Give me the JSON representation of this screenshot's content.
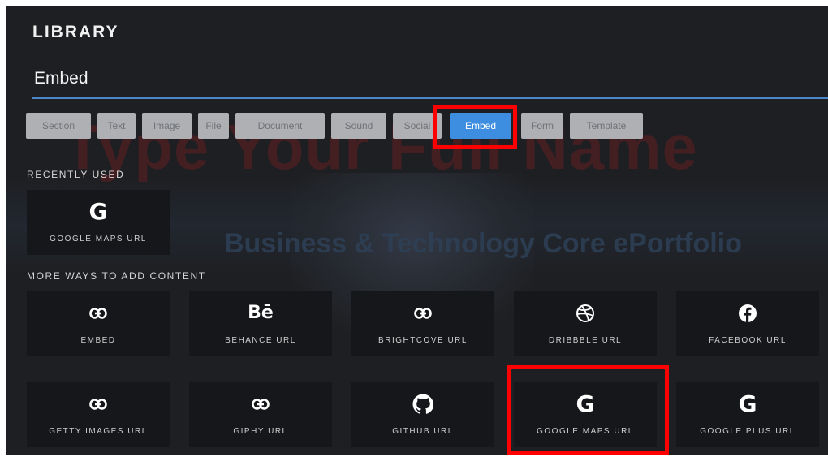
{
  "library": {
    "title": "LIBRARY",
    "heading": "Embed"
  },
  "tabs": [
    {
      "label": "Section"
    },
    {
      "label": "Text"
    },
    {
      "label": "Image"
    },
    {
      "label": "File"
    },
    {
      "label": "Document"
    },
    {
      "label": "Sound"
    },
    {
      "label": "Social"
    },
    {
      "label": "Embed",
      "active": true
    },
    {
      "label": "Form"
    },
    {
      "label": "Template"
    }
  ],
  "background_site": {
    "name_text": "Type Your Full Name",
    "subtitle_text": "Business & Technology Core ePortfolio"
  },
  "recently_used": {
    "label": "RECENTLY USED",
    "items": [
      {
        "label": "GOOGLE MAPS URL",
        "icon": "google-icon"
      }
    ]
  },
  "more_ways": {
    "label": "MORE WAYS TO ADD CONTENT",
    "items": [
      {
        "label": "EMBED",
        "icon": "link-icon"
      },
      {
        "label": "BEHANCE URL",
        "icon": "behance-icon"
      },
      {
        "label": "BRIGHTCOVE URL",
        "icon": "link-icon"
      },
      {
        "label": "DRIBBBLE URL",
        "icon": "dribbble-icon"
      },
      {
        "label": "FACEBOOK URL",
        "icon": "facebook-icon"
      },
      {
        "label": "GETTY IMAGES URL",
        "icon": "link-icon"
      },
      {
        "label": "GIPHY URL",
        "icon": "link-icon"
      },
      {
        "label": "GITHUB URL",
        "icon": "github-icon"
      },
      {
        "label": "GOOGLE MAPS URL",
        "icon": "google-icon"
      },
      {
        "label": "GOOGLE PLUS URL",
        "icon": "google-icon"
      }
    ]
  },
  "colors": {
    "panel_bg": "#1e1f22",
    "tile_bg": "#16171a",
    "tab_bg": "#aeb0b4",
    "tab_active": "#3d8de0",
    "accent_rule": "#4c86c7",
    "highlight": "#ff0000"
  }
}
